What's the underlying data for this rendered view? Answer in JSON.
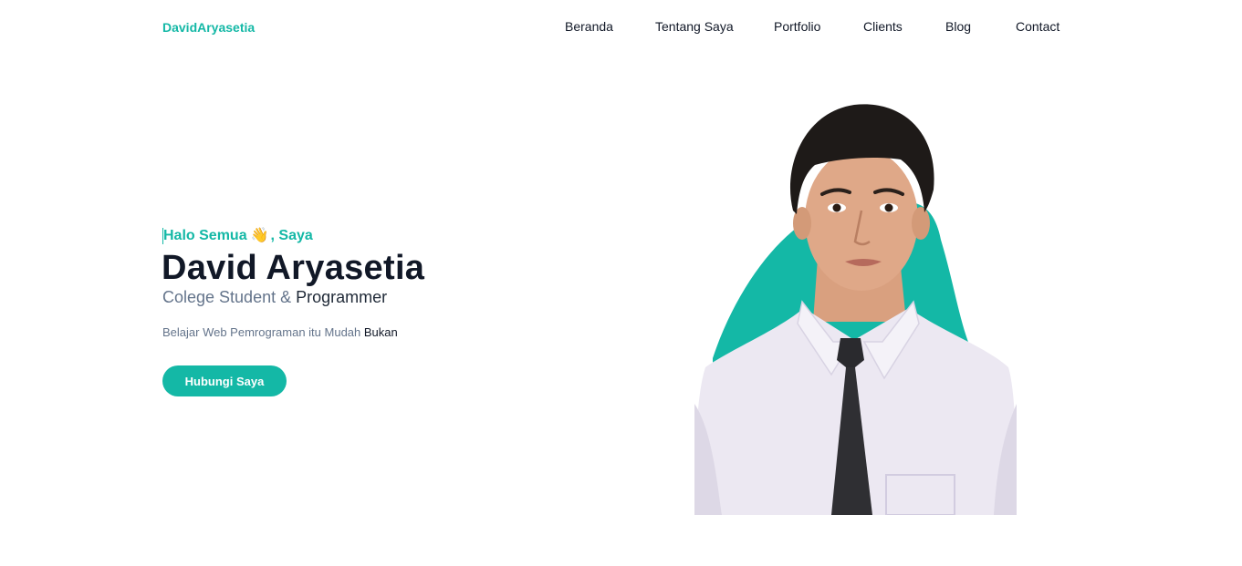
{
  "brand": {
    "name": "DavidAryasetia"
  },
  "nav": {
    "items": [
      {
        "label": "Beranda"
      },
      {
        "label": "Tentang Saya"
      },
      {
        "label": "Portfolio"
      },
      {
        "label": "Clients"
      },
      {
        "label": "Blog"
      },
      {
        "label": "Contact"
      }
    ]
  },
  "hero": {
    "greeting_prefix": "Halo Semua",
    "greeting_icon": "waving-hand-icon",
    "greeting_suffix": ", Saya",
    "name": "David Aryasetia",
    "subtitle_part1": "Colege Student & ",
    "subtitle_part2": "Programmer",
    "desc_part1": "Belajar Web Pemrograman itu Mudah ",
    "desc_part2": "Bukan",
    "cta_label": "Hubungi Saya"
  },
  "colors": {
    "accent": "#14b8a6",
    "heading": "#111827",
    "muted": "#64748b"
  }
}
